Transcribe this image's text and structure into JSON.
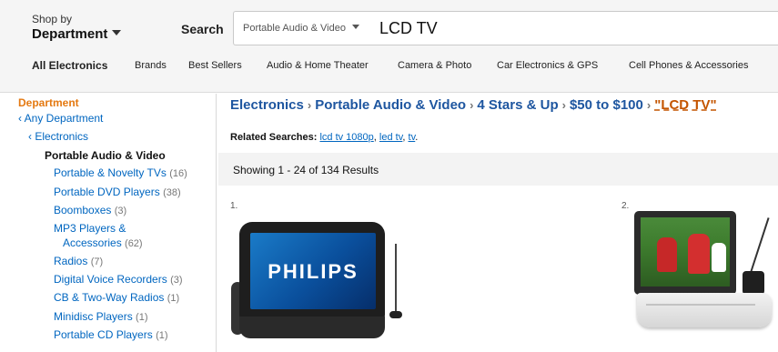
{
  "header": {
    "shop_by": "Shop by",
    "department": "Department",
    "search_label": "Search",
    "search_scope": "Portable Audio & Video",
    "search_query": "LCD TV"
  },
  "nav": {
    "items": [
      "All Electronics",
      "Brands",
      "Best Sellers",
      "Audio & Home Theater",
      "Camera & Photo",
      "Car Electronics & GPS",
      "Cell Phones & Accessories"
    ]
  },
  "sidebar": {
    "heading": "Department",
    "any_department": "‹ Any Department",
    "electronics": "‹ Electronics",
    "current": "Portable Audio & Video",
    "categories": [
      {
        "label": "Portable & Novelty TVs",
        "count": "(16)"
      },
      {
        "label": "Portable DVD Players",
        "count": "(38)"
      },
      {
        "label": "Boomboxes",
        "count": "(3)"
      },
      {
        "label": "MP3 Players &",
        "label2": "Accessories",
        "count": "(62)"
      },
      {
        "label": "Radios",
        "count": "(7)"
      },
      {
        "label": "Digital Voice Recorders",
        "count": "(3)"
      },
      {
        "label": "CB & Two-Way Radios",
        "count": "(1)"
      },
      {
        "label": "Minidisc Players",
        "count": "(1)"
      },
      {
        "label": "Portable CD Players",
        "count": "(1)"
      }
    ]
  },
  "breadcrumb": {
    "items": [
      "Electronics",
      "Portable Audio & Video",
      "4 Stars & Up",
      "$50 to $100"
    ],
    "query": "\"LCD TV\"",
    "separator": "›"
  },
  "related": {
    "label": "Related Searches:",
    "links": [
      "lcd tv 1080p",
      "led tv",
      "tv"
    ]
  },
  "results": {
    "text": "Showing 1 - 24 of 134 Results"
  },
  "products": [
    {
      "num": "1.",
      "brand": "PHILIPS"
    },
    {
      "num": "2."
    }
  ],
  "colors": {
    "link": "#0066c0",
    "breadcrumb": "#1e56a0",
    "accent": "#e47911",
    "query": "#c45500"
  }
}
